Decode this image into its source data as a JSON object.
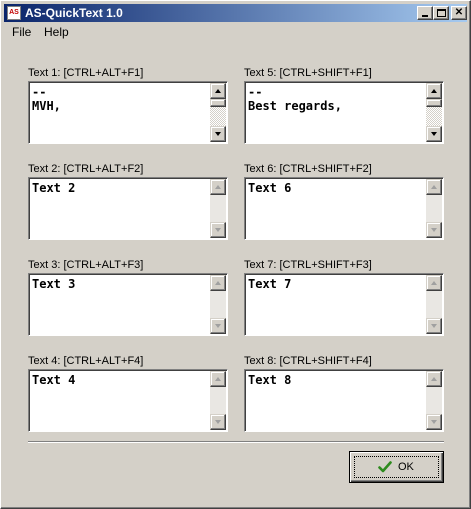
{
  "window": {
    "title": "AS-QuickText 1.0",
    "icon_text": "AS",
    "controls": [
      "minimize-icon",
      "maximize-icon",
      "close-icon"
    ]
  },
  "menu": {
    "file": "File",
    "help": "Help"
  },
  "groups": [
    {
      "label": "Text 1: [CTRL+ALT+F1]",
      "content": "--\nMVH,",
      "scroll_active": true
    },
    {
      "label": "Text 2: [CTRL+ALT+F2]",
      "content": "Text 2",
      "scroll_active": false
    },
    {
      "label": "Text 3: [CTRL+ALT+F3]",
      "content": "Text 3",
      "scroll_active": false
    },
    {
      "label": "Text 4: [CTRL+ALT+F4]",
      "content": "Text 4",
      "scroll_active": false
    },
    {
      "label": "Text 5: [CTRL+SHIFT+F1]",
      "content": "--\nBest regards,",
      "scroll_active": true
    },
    {
      "label": "Text 6: [CTRL+SHIFT+F2]",
      "content": "Text 6",
      "scroll_active": false
    },
    {
      "label": "Text 7: [CTRL+SHIFT+F3]",
      "content": "Text 7",
      "scroll_active": false
    },
    {
      "label": "Text 8: [CTRL+SHIFT+F4]",
      "content": "Text 8",
      "scroll_active": false
    }
  ],
  "ok_button": {
    "label": "OK",
    "icon": "checkmark-icon",
    "icon_color": "#2e8b1e"
  },
  "colors": {
    "titlebar_start": "#0a246a",
    "titlebar_end": "#a6caf0",
    "face": "#d4d0c8"
  }
}
